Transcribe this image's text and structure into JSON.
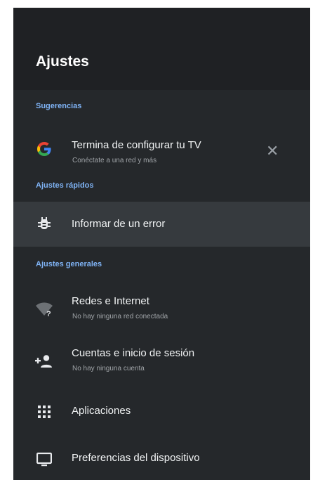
{
  "header": {
    "title": "Ajustes"
  },
  "sections": {
    "suggestions": "Sugerencias",
    "quick": "Ajustes rápidos",
    "general": "Ajustes generales"
  },
  "suggestion": {
    "title": "Termina de configurar tu TV",
    "subtitle": "Conéctate a una red y más",
    "dismiss": "✕"
  },
  "quick_items": [
    {
      "label": "Informar de un error",
      "icon": "bug-icon"
    }
  ],
  "general_items": [
    {
      "label": "Redes e Internet",
      "subtitle": "No hay ninguna red conectada",
      "icon": "wifi-question-icon"
    },
    {
      "label": "Cuentas e inicio de sesión",
      "subtitle": "No hay ninguna cuenta",
      "icon": "add-account-icon"
    },
    {
      "label": "Aplicaciones",
      "icon": "apps-grid-icon"
    },
    {
      "label": "Preferencias del dispositivo",
      "icon": "monitor-icon"
    }
  ],
  "colors": {
    "accent": "#7fb3f5",
    "background": "#25282b",
    "header": "#1f2124",
    "highlight": "#363a3e"
  }
}
